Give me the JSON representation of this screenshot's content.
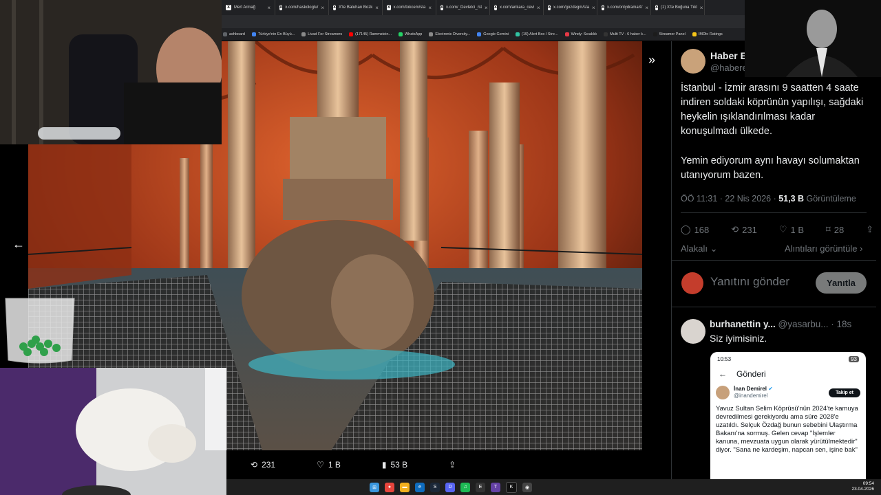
{
  "browser": {
    "tabs": [
      {
        "label": "Mert Armağ"
      },
      {
        "label": "x.com/haskologlu/"
      },
      {
        "label": "X'te Batuhan Bozk"
      },
      {
        "label": "x.com/tokcem/sta"
      },
      {
        "label": "x.com/_Devletci_/st"
      },
      {
        "label": "x.com/ankara_cevi"
      },
      {
        "label": "x.com/gozdegm/sta"
      },
      {
        "label": "x.com/onlydramaX/"
      },
      {
        "label": "(1) X'te Boğuna Tıkl"
      }
    ],
    "bookmarks": [
      {
        "label": "ashboard",
        "color": "#5f6368"
      },
      {
        "label": "Türkiye'nin En Büyü...",
        "color": "#4285f4"
      },
      {
        "label": "Livad For Streamers",
        "color": "#8a8a8a"
      },
      {
        "label": "(17145) Rammstein...",
        "color": "#ff0000"
      },
      {
        "label": "WhatsApp",
        "color": "#25d366"
      },
      {
        "label": "Electronic Diversity...",
        "color": "#8a8a8a"
      },
      {
        "label": "Google Gemini",
        "color": "#4285f4"
      },
      {
        "label": "(19) Alert Box / Stre...",
        "color": "#31c3a2"
      },
      {
        "label": "Windy: Sıcaklık",
        "color": "#e63946"
      },
      {
        "label": "Multi TV - 6 haber k...",
        "color": "#333333"
      },
      {
        "label": "Streamer Panel",
        "color": "#1c1c1c"
      },
      {
        "label": "IMDb: Ratings",
        "color": "#f5c518"
      }
    ]
  },
  "viewer": {
    "actions": {
      "retweets": "231",
      "likes": "1 B",
      "views": "53 B"
    }
  },
  "tweet": {
    "author_name": "Haber Ec",
    "author_handle": "@haberel",
    "body_1": "İstanbul - İzmir arasını 9 saatten 4 saate indiren soldaki köprünün yapılışı, sağdaki heykelin ışıklandırılması kadar konuşulmadı ülkede.",
    "body_2": "Yemin ediyorum aynı havayı solumaktan utanıyorum bazen.",
    "time": "ÖÖ 11:31 · 22 Nis 2026 · ",
    "views_count": "51,3 B",
    "views_label": "Görüntüleme",
    "counts": {
      "replies": "168",
      "retweets": "231",
      "likes": "1 B",
      "bookmarks": "28"
    },
    "related_label": "Alakalı",
    "quotes_label": "Alıntıları görüntüle",
    "reply_placeholder": "Yanıtını gönder",
    "reply_button": "Yanıtla"
  },
  "reply": {
    "name": "burhanettin y...",
    "handle": "@yasarbu...",
    "time": "· 18s",
    "text": "Siz iyimisiniz."
  },
  "phone": {
    "status_time": "10:53",
    "battery": "93",
    "header": "Gönderi",
    "name": "İnan Demirel",
    "handle": "@inandemirel",
    "follow": "Takip et",
    "text": "Yavuz Sultan Selim Köprüsü'nün 2024'te kamuya devredilmesi gerekiyordu ama süre 2028'e uzatıldı. Selçuk Özdağ bunun sebebini Ulaştırma Bakanı'na sormuş. Gelen cevap \"İşlemler kanuna, mevzuata uygun olarak yürütülmektedir\" diyor. \"Sana ne kardeşim, napcan sen, işine bak\""
  },
  "taskbar": {
    "time": "09:54",
    "date": "23.04.2026"
  },
  "colors": {
    "accent": "#1d9bf0",
    "cistern": "#b3421f"
  }
}
